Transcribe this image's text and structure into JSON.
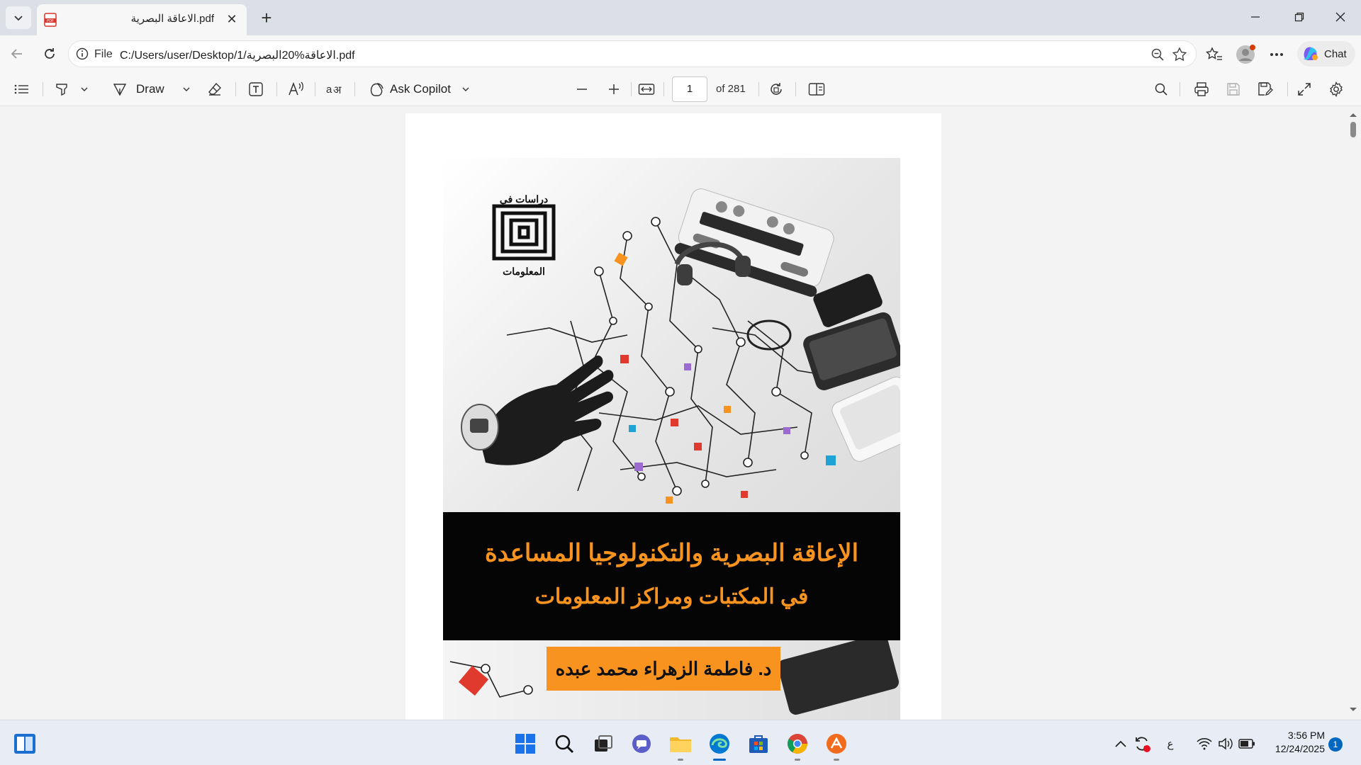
{
  "tab": {
    "title": "الاعاقة البصرية.pdf"
  },
  "address": {
    "scheme": "File",
    "url": "C:/Users/user/Desktop/1/الاعاقة%20البصرية.pdf"
  },
  "browser": {
    "chat_label": "Chat"
  },
  "pdf_toolbar": {
    "draw_label": "Draw",
    "copilot_label": "Ask Copilot",
    "page_number": "1",
    "page_total": "of 281"
  },
  "document": {
    "series_logo_top": "دراسات في",
    "series_logo_bottom": "المعلومات",
    "title_line1": "الإعاقة البصرية والتكنولوجيا المساعدة",
    "title_line2": "في المكتبات ومراكز المعلومات",
    "author": "د. فاطمة الزهراء محمد عبده"
  },
  "taskbar": {
    "language": "ع",
    "time": "3:56 PM",
    "date": "12/24/2025",
    "notifications": "1"
  },
  "colors": {
    "accent_orange": "#f7931e",
    "banner_black": "#050505",
    "edge_blue": "#0078d4"
  }
}
